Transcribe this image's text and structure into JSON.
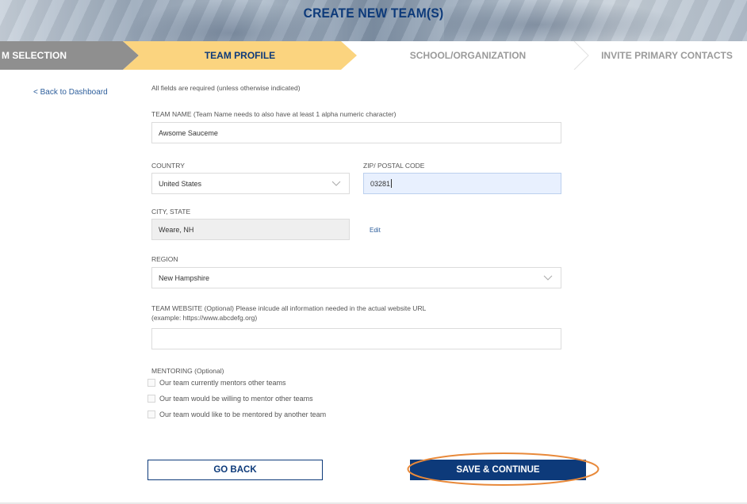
{
  "header": {
    "title": "CREATE NEW TEAM(S)"
  },
  "steps": [
    {
      "label": "M SELECTION",
      "state": "completed"
    },
    {
      "label": "TEAM PROFILE",
      "state": "active"
    },
    {
      "label": "SCHOOL/ORGANIZATION",
      "state": "upcoming"
    },
    {
      "label": "INVITE PRIMARY CONTACTS",
      "state": "upcoming"
    }
  ],
  "nav": {
    "back_link": "< Back to Dashboard"
  },
  "form": {
    "required_note": "All fields are required (unless otherwise indicated)",
    "team_name": {
      "label": "TEAM NAME (Team Name needs to also have at least 1 alpha numeric character)",
      "value": "Awsome Sauceme"
    },
    "country": {
      "label": "COUNTRY",
      "value": "United States"
    },
    "zip": {
      "label": "ZIP/ POSTAL CODE",
      "value": "03281"
    },
    "city_state": {
      "label": "CITY, STATE",
      "value": "Weare, NH",
      "edit_label": "Edit"
    },
    "region": {
      "label": "REGION",
      "value": "New Hampshire"
    },
    "website": {
      "label_line1": "TEAM WEBSITE (Optional) Please inlcude all information needed in the actual website URL",
      "label_line2": "(example: https://www.abcdefg.org)",
      "value": ""
    },
    "mentoring": {
      "label": "MENTORING (Optional)",
      "options": [
        {
          "label": "Our team currently mentors other teams",
          "checked": false
        },
        {
          "label": "Our team would be willing to mentor other teams",
          "checked": false
        },
        {
          "label": "Our team would like to be mentored by another team",
          "checked": false
        }
      ]
    }
  },
  "buttons": {
    "go_back": "GO BACK",
    "save_continue": "SAVE & CONTINUE"
  },
  "colors": {
    "brand_navy": "#0d3a7a",
    "active_step": "#fbd47f",
    "completed_step": "#8f8f8f",
    "annotation_ring": "#e8893a",
    "focused_field": "#e8f0fe"
  },
  "icons": {
    "select_arrow": "chevron-down-icon",
    "step_separator": "chevron-right-icon"
  }
}
